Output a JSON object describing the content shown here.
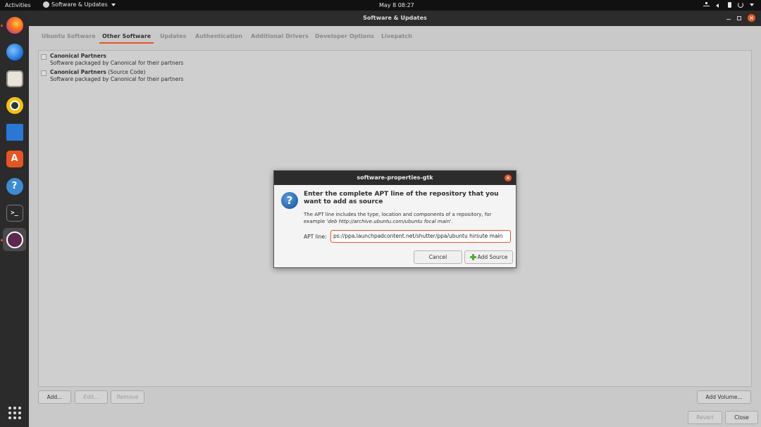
{
  "topbar": {
    "activities": "Activities",
    "app_menu": "Software & Updates",
    "clock": "May 8  08:27"
  },
  "dock": {
    "items": [
      "firefox-icon",
      "thunderbird-icon",
      "files-icon",
      "rhythmbox-icon",
      "libreoffice-writer-icon",
      "ubuntu-software-icon",
      "help-icon",
      "terminal-icon",
      "software-updates-icon",
      "show-applications-icon"
    ],
    "terminal_glyph": ">_",
    "help_glyph": "?",
    "store_glyph": "A"
  },
  "window": {
    "title": "Software & Updates",
    "close_glyph": "×",
    "tabs": [
      {
        "label": "Ubuntu Software",
        "active": false
      },
      {
        "label": "Other Software",
        "active": true
      },
      {
        "label": "Updates",
        "active": false
      },
      {
        "label": "Authentication",
        "active": false
      },
      {
        "label": "Additional Drivers",
        "active": false
      },
      {
        "label": "Developer Options",
        "active": false
      },
      {
        "label": "Livepatch",
        "active": false
      }
    ],
    "repos": [
      {
        "name": "Canonical Partners",
        "suffix": "",
        "description": "Software packaged by Canonical for their partners",
        "checked": false
      },
      {
        "name": "Canonical Partners",
        "suffix": " (Source Code)",
        "description": "Software packaged by Canonical for their partners",
        "checked": false
      }
    ],
    "buttons": {
      "add": "Add...",
      "edit": "Edit...",
      "remove": "Remove",
      "add_volume": "Add Volume...",
      "revert": "Revert",
      "close": "Close"
    }
  },
  "dialog": {
    "title": "software-properties-gtk",
    "close_glyph": "×",
    "question_glyph": "?",
    "heading": "Enter the complete APT line of the repository that you want to add as source",
    "body_prefix": "The APT line includes the type, location and components of a repository, for example ",
    "body_example": "'deb http://archive.ubuntu.com/ubuntu focal main'",
    "body_suffix": ".",
    "apt_label": "APT line:",
    "apt_value": "ps://ppa.launchpadcontent.net/shutter/ppa/ubuntu hirsute main",
    "cancel": "Cancel",
    "add_source": "Add Source"
  }
}
